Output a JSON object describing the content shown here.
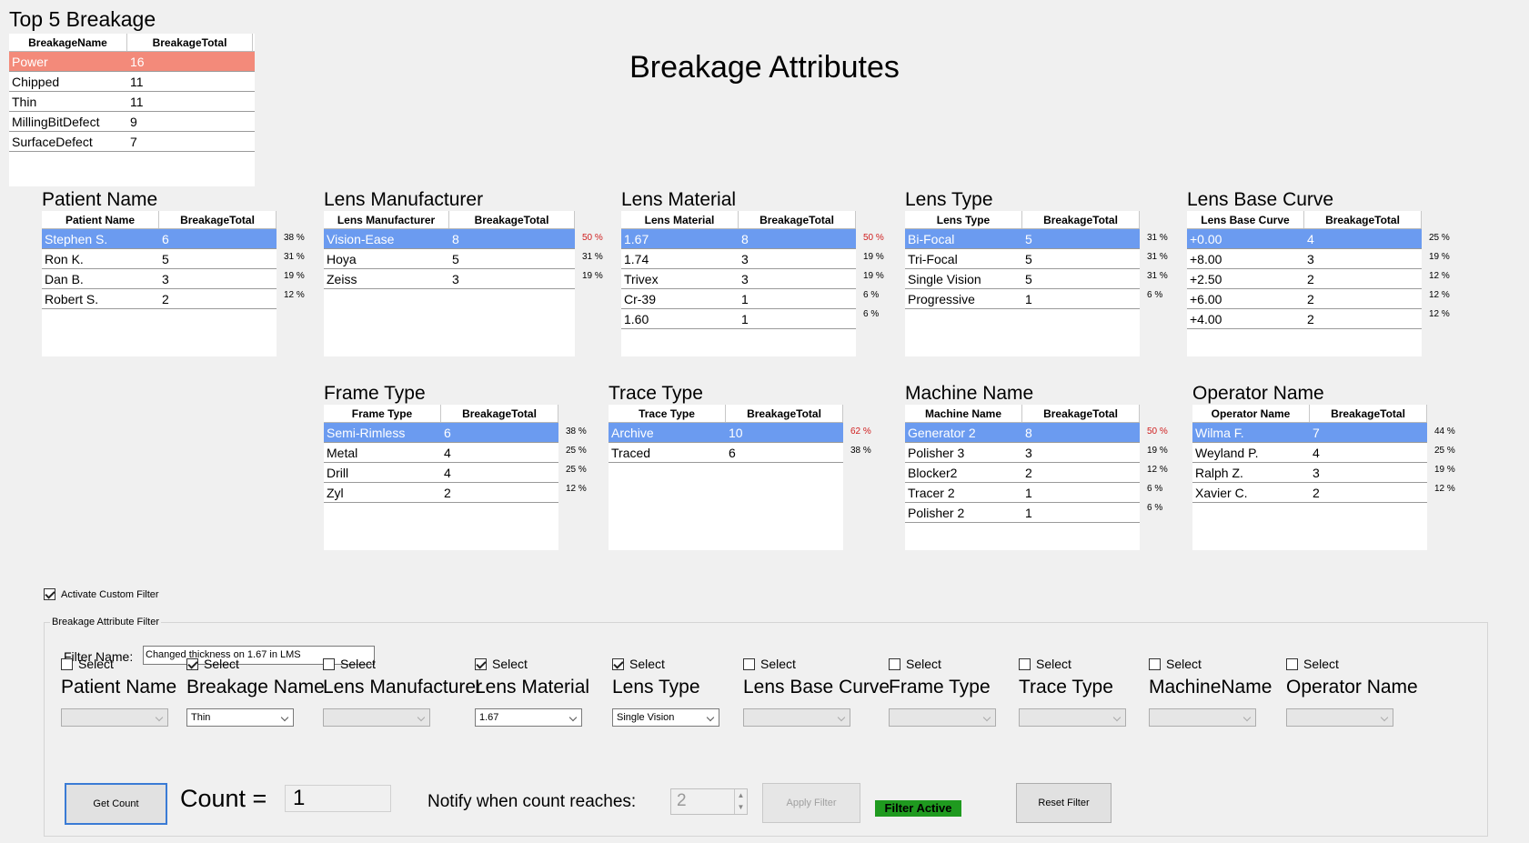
{
  "top5": {
    "title": "Top 5 Breakage",
    "headers": [
      "BreakageName",
      "BreakageTotal"
    ],
    "rows": [
      [
        "Power",
        "16"
      ],
      [
        "Chipped",
        "11"
      ],
      [
        "Thin",
        "11"
      ],
      [
        "MillingBitDefect",
        "9"
      ],
      [
        "SurfaceDefect",
        "7"
      ]
    ]
  },
  "main_title": "Breakage Attributes",
  "grids": {
    "patient": {
      "title": "Patient Name",
      "headers": [
        "Patient Name",
        "BreakageTotal"
      ],
      "rows": [
        [
          "Stephen S.",
          "6"
        ],
        [
          "Ron K.",
          "5"
        ],
        [
          "Dan B.",
          "3"
        ],
        [
          "Robert S.",
          "2"
        ]
      ],
      "pcts": [
        "38 %",
        "31 %",
        "19 %",
        "12 %"
      ]
    },
    "manufacturer": {
      "title": "Lens Manufacturer",
      "headers": [
        "Lens Manufacturer",
        "BreakageTotal"
      ],
      "rows": [
        [
          "Vision-Ease",
          "8"
        ],
        [
          "Hoya",
          "5"
        ],
        [
          "Zeiss",
          "3"
        ]
      ],
      "pcts": [
        "50 %",
        "31 %",
        "19 %"
      ]
    },
    "material": {
      "title": "Lens Material",
      "headers": [
        "Lens Material",
        "BreakageTotal"
      ],
      "rows": [
        [
          "1.67",
          "8"
        ],
        [
          "1.74",
          "3"
        ],
        [
          "Trivex",
          "3"
        ],
        [
          "Cr-39",
          "1"
        ],
        [
          "1.60",
          "1"
        ]
      ],
      "pcts": [
        "50 %",
        "19 %",
        "19 %",
        "6 %",
        "6 %"
      ]
    },
    "lenstype": {
      "title": "Lens Type",
      "headers": [
        "Lens Type",
        "BreakageTotal"
      ],
      "rows": [
        [
          "Bi-Focal",
          "5"
        ],
        [
          "Tri-Focal",
          "5"
        ],
        [
          "Single Vision",
          "5"
        ],
        [
          "Progressive",
          "1"
        ]
      ],
      "pcts": [
        "31 %",
        "31 %",
        "31 %",
        "6 %"
      ]
    },
    "basecurve": {
      "title": "Lens Base Curve",
      "headers": [
        "Lens Base Curve",
        "BreakageTotal"
      ],
      "rows": [
        [
          "+0.00",
          "4"
        ],
        [
          "+8.00",
          "3"
        ],
        [
          "+2.50",
          "2"
        ],
        [
          "+6.00",
          "2"
        ],
        [
          "+4.00",
          "2"
        ]
      ],
      "pcts": [
        "25 %",
        "19 %",
        "12 %",
        "12 %",
        "12 %"
      ]
    },
    "frametype": {
      "title": "Frame Type",
      "headers": [
        "Frame Type",
        "BreakageTotal"
      ],
      "rows": [
        [
          "Semi-Rimless",
          "6"
        ],
        [
          "Metal",
          "4"
        ],
        [
          "Drill",
          "4"
        ],
        [
          "Zyl",
          "2"
        ]
      ],
      "pcts": [
        "38 %",
        "25 %",
        "25 %",
        "12 %"
      ]
    },
    "tracetype": {
      "title": "Trace Type",
      "headers": [
        "Trace Type",
        "BreakageTotal"
      ],
      "rows": [
        [
          "Archive",
          "10"
        ],
        [
          "Traced",
          "6"
        ]
      ],
      "pcts": [
        "62 %",
        "38 %"
      ]
    },
    "machine": {
      "title": "Machine Name",
      "headers": [
        "Machine Name",
        "BreakageTotal"
      ],
      "rows": [
        [
          "Generator 2",
          "8"
        ],
        [
          "Polisher 3",
          "3"
        ],
        [
          "Blocker2",
          "2"
        ],
        [
          "Tracer 2",
          "1"
        ],
        [
          "Polisher 2",
          "1"
        ]
      ],
      "pcts": [
        "50 %",
        "19 %",
        "12 %",
        "6 %",
        "6 %"
      ]
    },
    "operator": {
      "title": "Operator Name",
      "headers": [
        "Operator Name",
        "BreakageTotal"
      ],
      "rows": [
        [
          "Wilma F.",
          "7"
        ],
        [
          "Weyland P.",
          "4"
        ],
        [
          "Ralph Z.",
          "3"
        ],
        [
          "Xavier C.",
          "2"
        ]
      ],
      "pcts": [
        "44 %",
        "25 %",
        "19 %",
        "12 %"
      ]
    }
  },
  "custom_filter": {
    "activate_label": "Activate Custom Filter",
    "activate_checked": true,
    "group_label": "Breakage Attribute Filter",
    "filter_name_label": "Filter Name:",
    "filter_name_value": "Changed thickness on 1.67 in LMS",
    "select_label": "Select",
    "columns": [
      {
        "head": "Patient Name",
        "checked": false,
        "value": ""
      },
      {
        "head": "Breakage Name",
        "checked": true,
        "value": "Thin"
      },
      {
        "head": "Lens Manufacturer",
        "checked": false,
        "value": ""
      },
      {
        "head": "Lens Material",
        "checked": true,
        "value": "1.67"
      },
      {
        "head": "Lens Type",
        "checked": true,
        "value": "Single Vision"
      },
      {
        "head": "Lens Base Curve",
        "checked": false,
        "value": ""
      },
      {
        "head": "Frame Type",
        "checked": false,
        "value": ""
      },
      {
        "head": "Trace Type",
        "checked": false,
        "value": ""
      },
      {
        "head": "MachineName",
        "checked": false,
        "value": ""
      },
      {
        "head": "Operator Name",
        "checked": false,
        "value": ""
      }
    ],
    "get_count_label": "Get Count",
    "count_label": "Count =",
    "count_value": "1",
    "notify_label": "Notify when count reaches:",
    "notify_value": "2",
    "apply_label": "Apply Filter",
    "status_label": "Filter Active",
    "reset_label": "Reset Filter"
  },
  "colors": {
    "selected_row": "#6b9bf0",
    "top_row": "#f38a7a",
    "filter_active_bg": "#1f9a1f",
    "percent_red": "#d02020"
  }
}
